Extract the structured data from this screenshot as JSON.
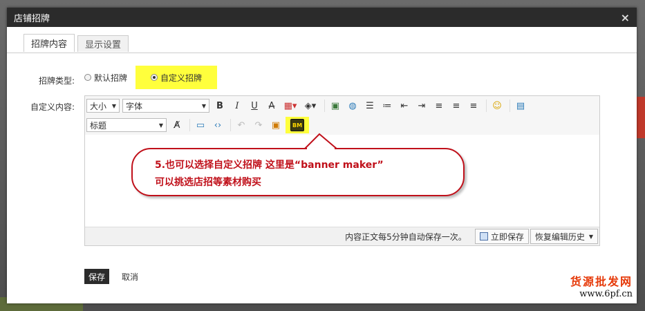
{
  "dialog": {
    "title": "店铺招牌",
    "close": "×"
  },
  "tabs": [
    {
      "label": "招牌内容",
      "active": true
    },
    {
      "label": "显示设置",
      "active": false
    }
  ],
  "form": {
    "type_label": "招牌类型:",
    "content_label": "自定义内容:",
    "radio_default": "默认招牌",
    "radio_custom": "自定义招牌",
    "selected": "custom"
  },
  "toolbar": {
    "font_size": "大小",
    "font_family": "字体",
    "heading": "标题",
    "icons": [
      "bold-icon",
      "italic-icon",
      "underline-icon",
      "strikethrough-icon",
      "font-color-icon",
      "highlight-color-icon",
      "image-icon",
      "link-icon",
      "bullet-list-icon",
      "numbered-list-icon",
      "outdent-icon",
      "indent-icon",
      "align-left-icon",
      "align-center-icon",
      "align-right-icon",
      "emoticon-icon",
      "table-icon",
      "clear-format-icon",
      "video-icon",
      "source-code-icon",
      "undo-icon",
      "redo-icon",
      "media-icon",
      "banner-maker-icon"
    ],
    "banner_maker": "BM"
  },
  "footer": {
    "autosave_text": "内容正文每5分钟自动保存一次。",
    "save_now": "立即保存",
    "restore_history": "恢复编辑历史"
  },
  "annotation": {
    "line1": "5.也可以选择自定义招牌  这里是“banner maker”",
    "line2": "可以挑选店招等素材购买"
  },
  "actions": {
    "save": "保存",
    "cancel": "取消"
  },
  "watermark": {
    "line1": "货源批发网",
    "line2": "www.6pf.cn"
  },
  "colors": {
    "highlight": "#ffff3c",
    "callout": "#c0101a",
    "titlebar": "#2b2b2b"
  }
}
